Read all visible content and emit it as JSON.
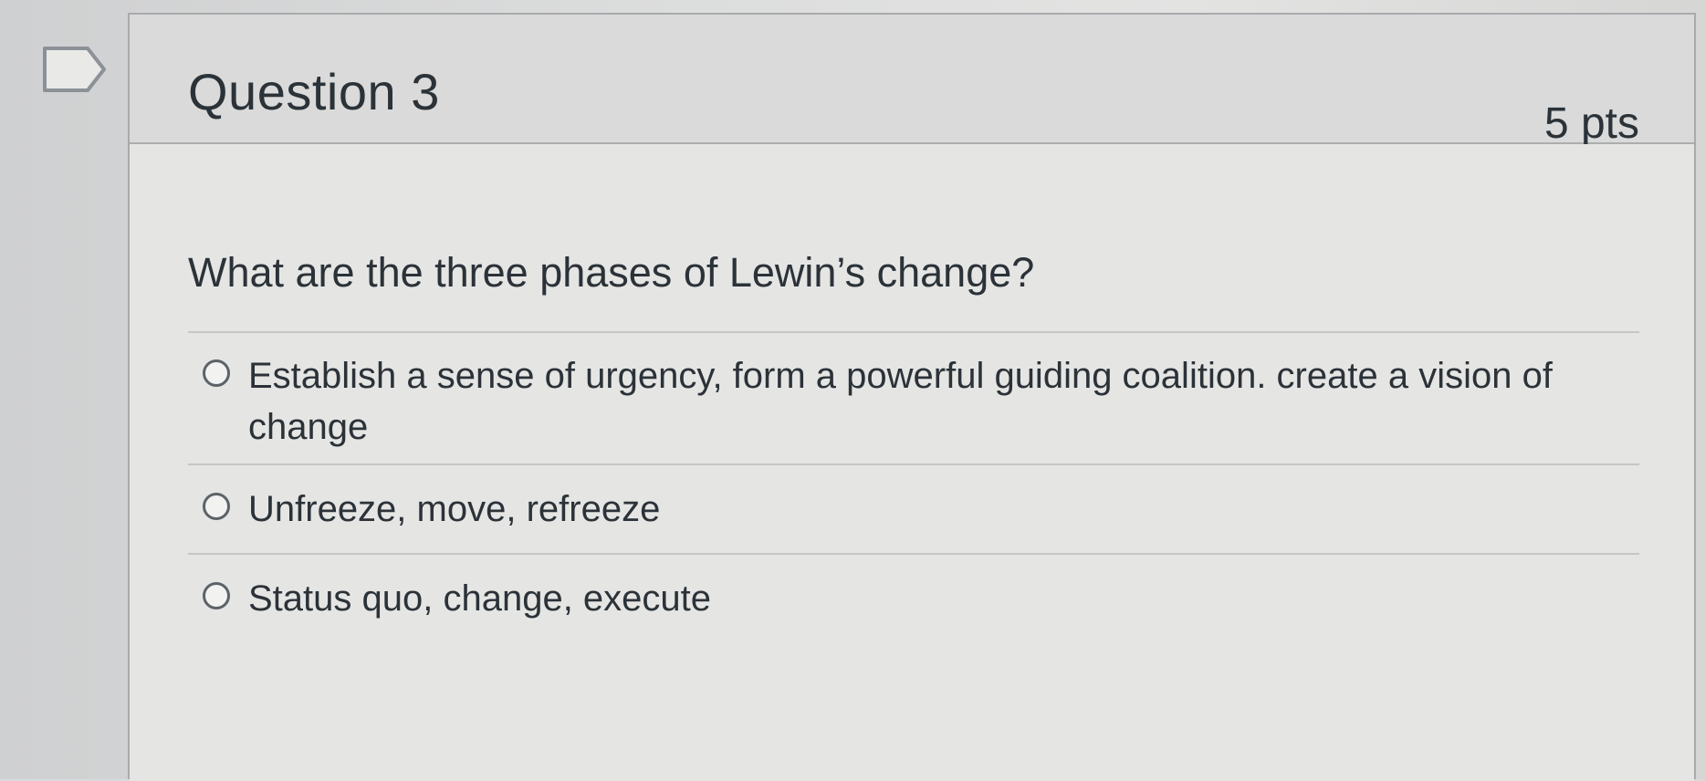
{
  "question": {
    "title": "Question 3",
    "points": "5 pts",
    "text": "What are the three phases of Lewin’s change?",
    "answers": [
      {
        "label": "Establish a sense of urgency, form a powerful guiding coalition. create a vision of change",
        "selected": false
      },
      {
        "label": "Unfreeze, move, refreeze",
        "selected": false
      },
      {
        "label": "Status quo, change, execute",
        "selected": false
      }
    ]
  },
  "icons": {
    "flag": "flag-question-icon",
    "radio": "radio-unchecked-icon"
  },
  "colors": {
    "card_border": "#a9aaab",
    "header_bg": "#d9dad9",
    "text": "#2b3238"
  }
}
